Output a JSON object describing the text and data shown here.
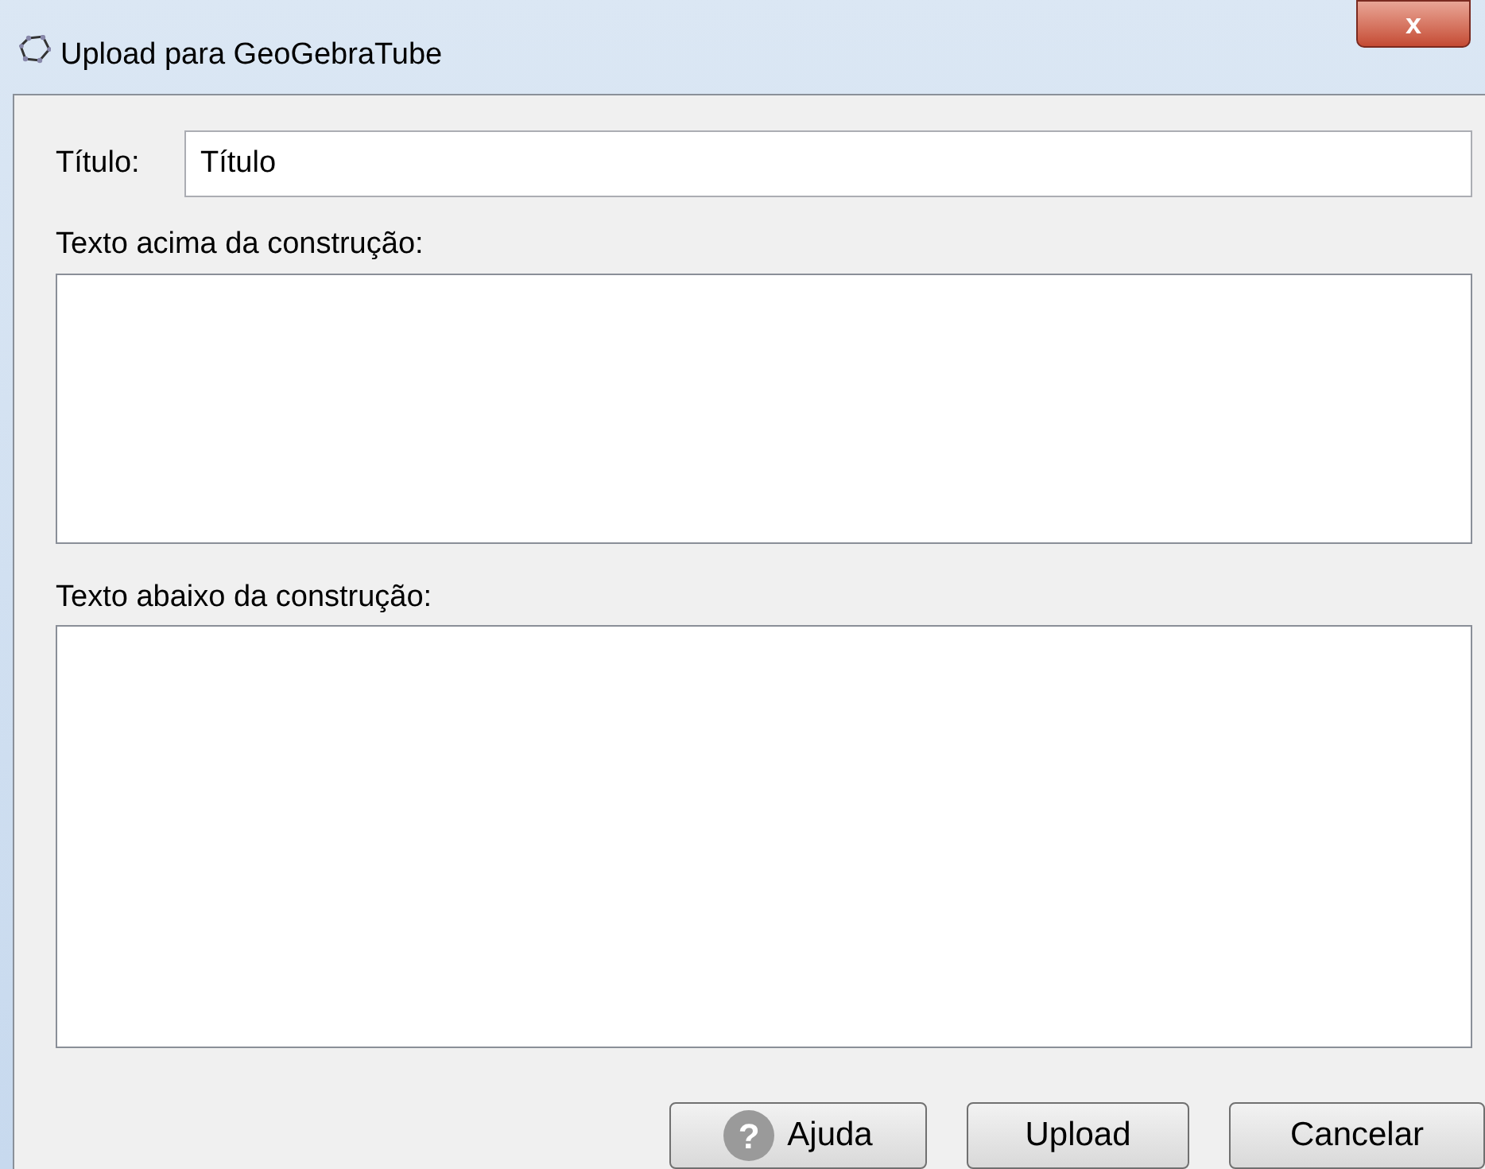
{
  "window": {
    "title": "Upload para GeoGebraTube",
    "close": "x"
  },
  "title_field": {
    "label": "Título:",
    "value": "Título"
  },
  "text_above": {
    "label": "Texto acima da construção:"
  },
  "text_below": {
    "label": "Texto abaixo da construção:"
  },
  "buttons": [
    {
      "kind": "help",
      "label": "Ajuda",
      "icon": "?"
    },
    {
      "kind": "plain",
      "label": "Upload"
    },
    {
      "kind": "plain",
      "label": "Cancelar"
    }
  ]
}
